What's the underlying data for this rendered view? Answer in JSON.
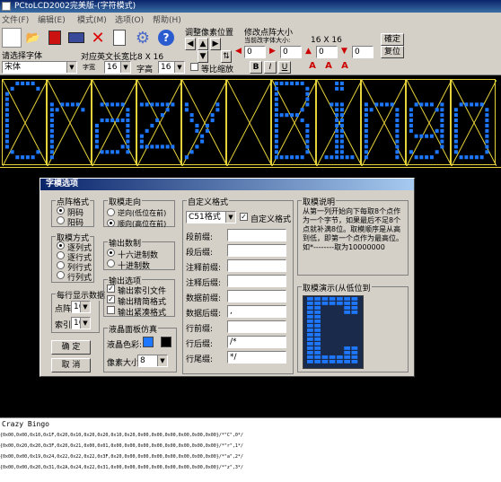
{
  "window": {
    "title": "PCtoLCD2002完美版-(字符模式)"
  },
  "menu": [
    "文件(F)",
    "编辑(E)",
    "模式(M)",
    "选项(O)",
    "帮助(H)"
  ],
  "toolbar": {
    "adjust_pos_label": "调整像素位置",
    "modify_size_label": "修改点阵大小",
    "current_size_label": "当前改字体大小:",
    "current_size_value": "16 X 16",
    "confirm_label": "確定",
    "restore_label": "复位",
    "font_prompt": "请选择字体",
    "font_value": "宋体",
    "char_size_label": "对应英文长宽比8 X 16",
    "width_label": "字宽",
    "width_value": "16",
    "height_label": "字高",
    "height_value": "16",
    "proportional_label": "等比缩放",
    "spin_values": [
      "0",
      "0",
      "0",
      "0"
    ],
    "bold_label": "B",
    "italic_label": "I",
    "underline_label": "U"
  },
  "display": {
    "text": "Crazy Bingo",
    "glyphs": [
      "C",
      "r",
      "a",
      "z",
      "y",
      "",
      "B",
      "i",
      "n",
      "g",
      "o"
    ],
    "dot_color": "#1e78ff",
    "grid_color": "#e6d23a"
  },
  "dialog": {
    "title": "字模选项",
    "dot_format": {
      "title": "点阵格式",
      "options": [
        "阴码",
        "阳码"
      ],
      "selected": 0
    },
    "scan_mode": {
      "title": "取模方式",
      "options": [
        "逐列式",
        "逐行式",
        "列行式",
        "行列式"
      ],
      "selected": 0
    },
    "per_line": {
      "title": "每行显示数据",
      "dot_label": "点阵:",
      "dot_value": "16",
      "index_label": "索引:",
      "index_value": "16"
    },
    "ok_label": "确 定",
    "cancel_label": "取 消",
    "direction": {
      "title": "取模走向",
      "options": [
        "逆向(低位在前)",
        "顺向(高位在前)"
      ],
      "selected": 1
    },
    "output_base": {
      "title": "输出数制",
      "options": [
        "十六进制数",
        "十进制数"
      ],
      "selected": 0
    },
    "output_opts": {
      "title": "输出选项",
      "options": [
        "输出索引文件",
        "输出精简格式",
        "输出紧凑格式"
      ],
      "checked": [
        true,
        true,
        false
      ]
    },
    "lcd": {
      "title": "液晶面板仿真",
      "color_label": "液晶色彩:",
      "pixel_label": "像素大小:",
      "pixel_value": "8",
      "color_on": "#1e78ff",
      "color_off": "#000000"
    },
    "custom": {
      "title": "自定义格式",
      "format_value": "C51格式",
      "custom_check_label": "自定义格式",
      "fields": [
        {
          "label": "段前缀:",
          "value": ""
        },
        {
          "label": "段后缀:",
          "value": ""
        },
        {
          "label": "注释前缀:",
          "value": ""
        },
        {
          "label": "注释后缀:",
          "value": ""
        },
        {
          "label": "数据前缀:",
          "value": ""
        },
        {
          "label": "数据后缀:",
          "value": ","
        },
        {
          "label": "行前缀:",
          "value": ""
        },
        {
          "label": "行后缀:",
          "value": "/*"
        },
        {
          "label": "行尾缀:",
          "value": "*/"
        }
      ]
    },
    "desc": {
      "title": "取模说明",
      "text": "从第一列开始向下每取8个点作为一个字节，如果最后不足8个点就补满8位。取模顺序是从高到低，即第一个点作为最高位。如*--------取为10000000"
    },
    "preview_title": "取模演示(从低位到"
  },
  "output": {
    "title": "Crazy Bingo",
    "lines": [
      "{0x00,0x00,0x10,0x1F,0x20,0x10,0x20,0x20,0x10,0x20,0x00,0x00,0x00,0x00,0x00,0x00}/*\"C\",0*/",
      "{0x00,0x20,0x20,0x3F,0x20,0x21,0x00,0x01,0x00,0x00,0x00,0x00,0x00,0x00,0x00,0x00}/*\"r\",1*/",
      "{0x00,0x00,0x19,0x24,0x22,0x22,0x22,0x3F,0x20,0x00,0x00,0x00,0x00,0x00,0x00,0x00}/*\"a\",2*/",
      "{0x00,0x00,0x20,0x31,0x2A,0x24,0x22,0x31,0x00,0x00,0x00,0x00,0x00,0x00,0x00,0x00}/*\"z\",3*/"
    ]
  }
}
